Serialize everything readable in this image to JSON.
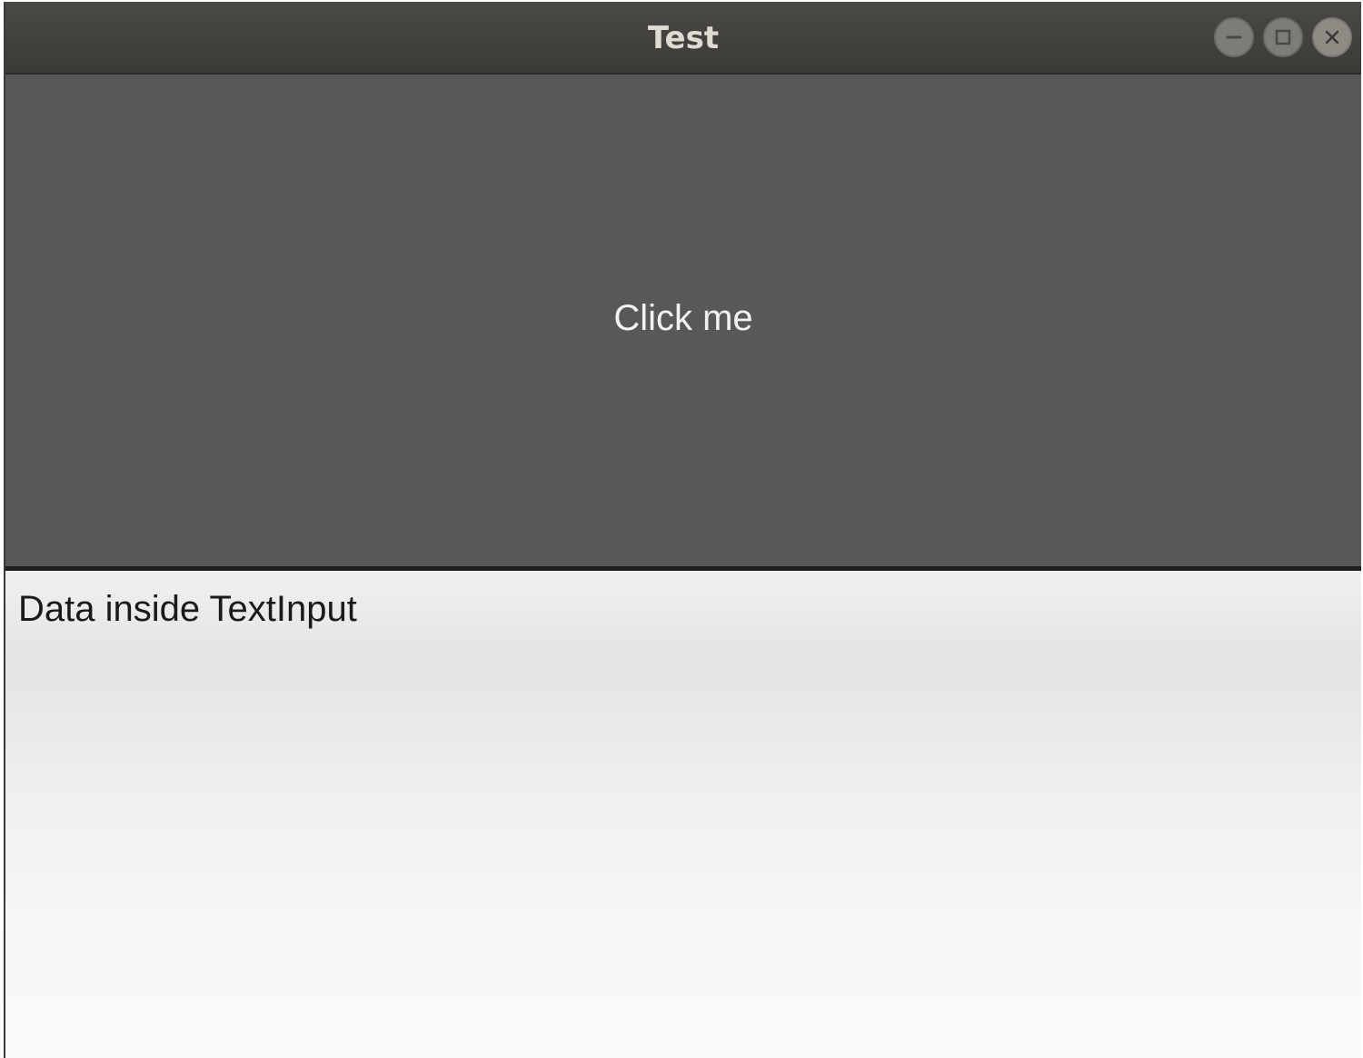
{
  "window": {
    "title": "Test",
    "controls": {
      "minimize_icon": "minimize-icon",
      "maximize_icon": "maximize-icon",
      "close_icon": "close-icon"
    }
  },
  "main": {
    "button_label": "Click me",
    "text_input_value": "Data inside TextInput"
  },
  "colors": {
    "titlebar": "#3f3e3b",
    "button_background": "#585857",
    "button_text": "#f2f2f2",
    "input_background": "#efefef",
    "input_text": "#1a1a1a"
  }
}
